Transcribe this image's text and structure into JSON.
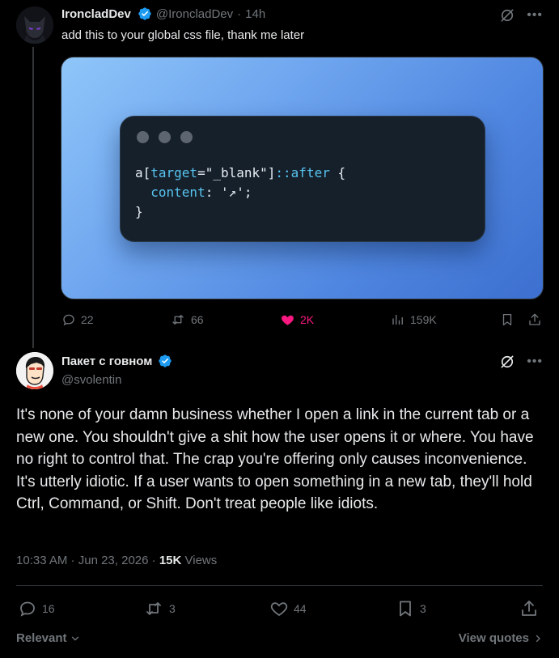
{
  "tweet1": {
    "display_name": "IroncladDev",
    "handle": "@IroncladDev",
    "separator": "·",
    "time": "14h",
    "text": "add this to your global css file, thank me later",
    "code": {
      "line1_selector": "a[",
      "line1_attr": "target",
      "line1_eq": "=",
      "line1_value": "\"_blank\"",
      "line1_close": "]",
      "line1_pseudo": "::after",
      "line1_brace": " {",
      "line2_indent": "  ",
      "line2_prop": "content",
      "line2_colon": ": ",
      "line2_value": "'↗'",
      "line2_semicolon": ";",
      "line3": "}"
    },
    "actions": {
      "replies": "22",
      "reposts": "66",
      "likes": "2K",
      "views": "159K"
    },
    "icons": [
      "grok-icon",
      "more-icon",
      "reply-icon",
      "repost-icon",
      "like-icon",
      "views-icon",
      "bookmark-icon",
      "share-icon"
    ],
    "like_color": "#f91880"
  },
  "tweet2": {
    "display_name": "Пакет с говном",
    "handle": "@svolentin",
    "text": "It's none of your damn business whether I open a link in the current tab or a new one. You shouldn't give a shit how the user opens it or where. You have no right to control that. The crap you're offering only causes inconvenience. It's utterly idiotic. If a user wants to open something in a new tab, they'll hold Ctrl, Command, or Shift. Don't treat people like idiots.",
    "meta": {
      "time": "10:33 AM",
      "separator1": " · ",
      "date": "Jun 23, 2026",
      "separator2": " · ",
      "views_count": "15K",
      "views_label": " Views"
    },
    "actions": {
      "replies": "16",
      "reposts": "3",
      "likes": "44",
      "bookmarks": "3"
    },
    "verified_color": "#1d9bf0"
  },
  "footer": {
    "sort_label": "Relevant",
    "view_quotes": "View quotes"
  }
}
